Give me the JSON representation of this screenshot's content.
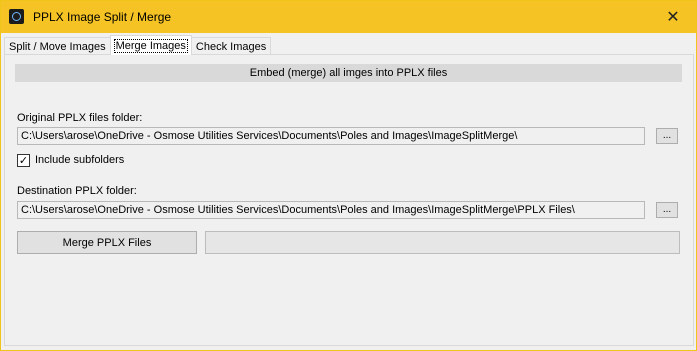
{
  "window": {
    "title": "PPLX Image Split / Merge",
    "close_glyph": "✕",
    "icon": "app-icon",
    "accent_color": "#f5c324"
  },
  "tabs": [
    {
      "label": "Split / Move Images",
      "active": false
    },
    {
      "label": "Merge Images",
      "active": true
    },
    {
      "label": "Check Images",
      "active": false
    }
  ],
  "panel": {
    "header": "Embed (merge) all imges into PPLX files",
    "original": {
      "label": "Original PPLX files folder:",
      "value": "C:\\Users\\arose\\OneDrive - Osmose Utilities Services\\Documents\\Poles and Images\\ImageSplitMerge\\",
      "browse_label": "..."
    },
    "include_subfolders": {
      "label": "Include subfolders",
      "checked": true,
      "check_glyph": "✓"
    },
    "destination": {
      "label": "Destination PPLX folder:",
      "value": "C:\\Users\\arose\\OneDrive - Osmose Utilities Services\\Documents\\Poles and Images\\ImageSplitMerge\\PPLX Files\\",
      "browse_label": "..."
    },
    "merge_button": "Merge PPLX Files",
    "progress": 0
  }
}
